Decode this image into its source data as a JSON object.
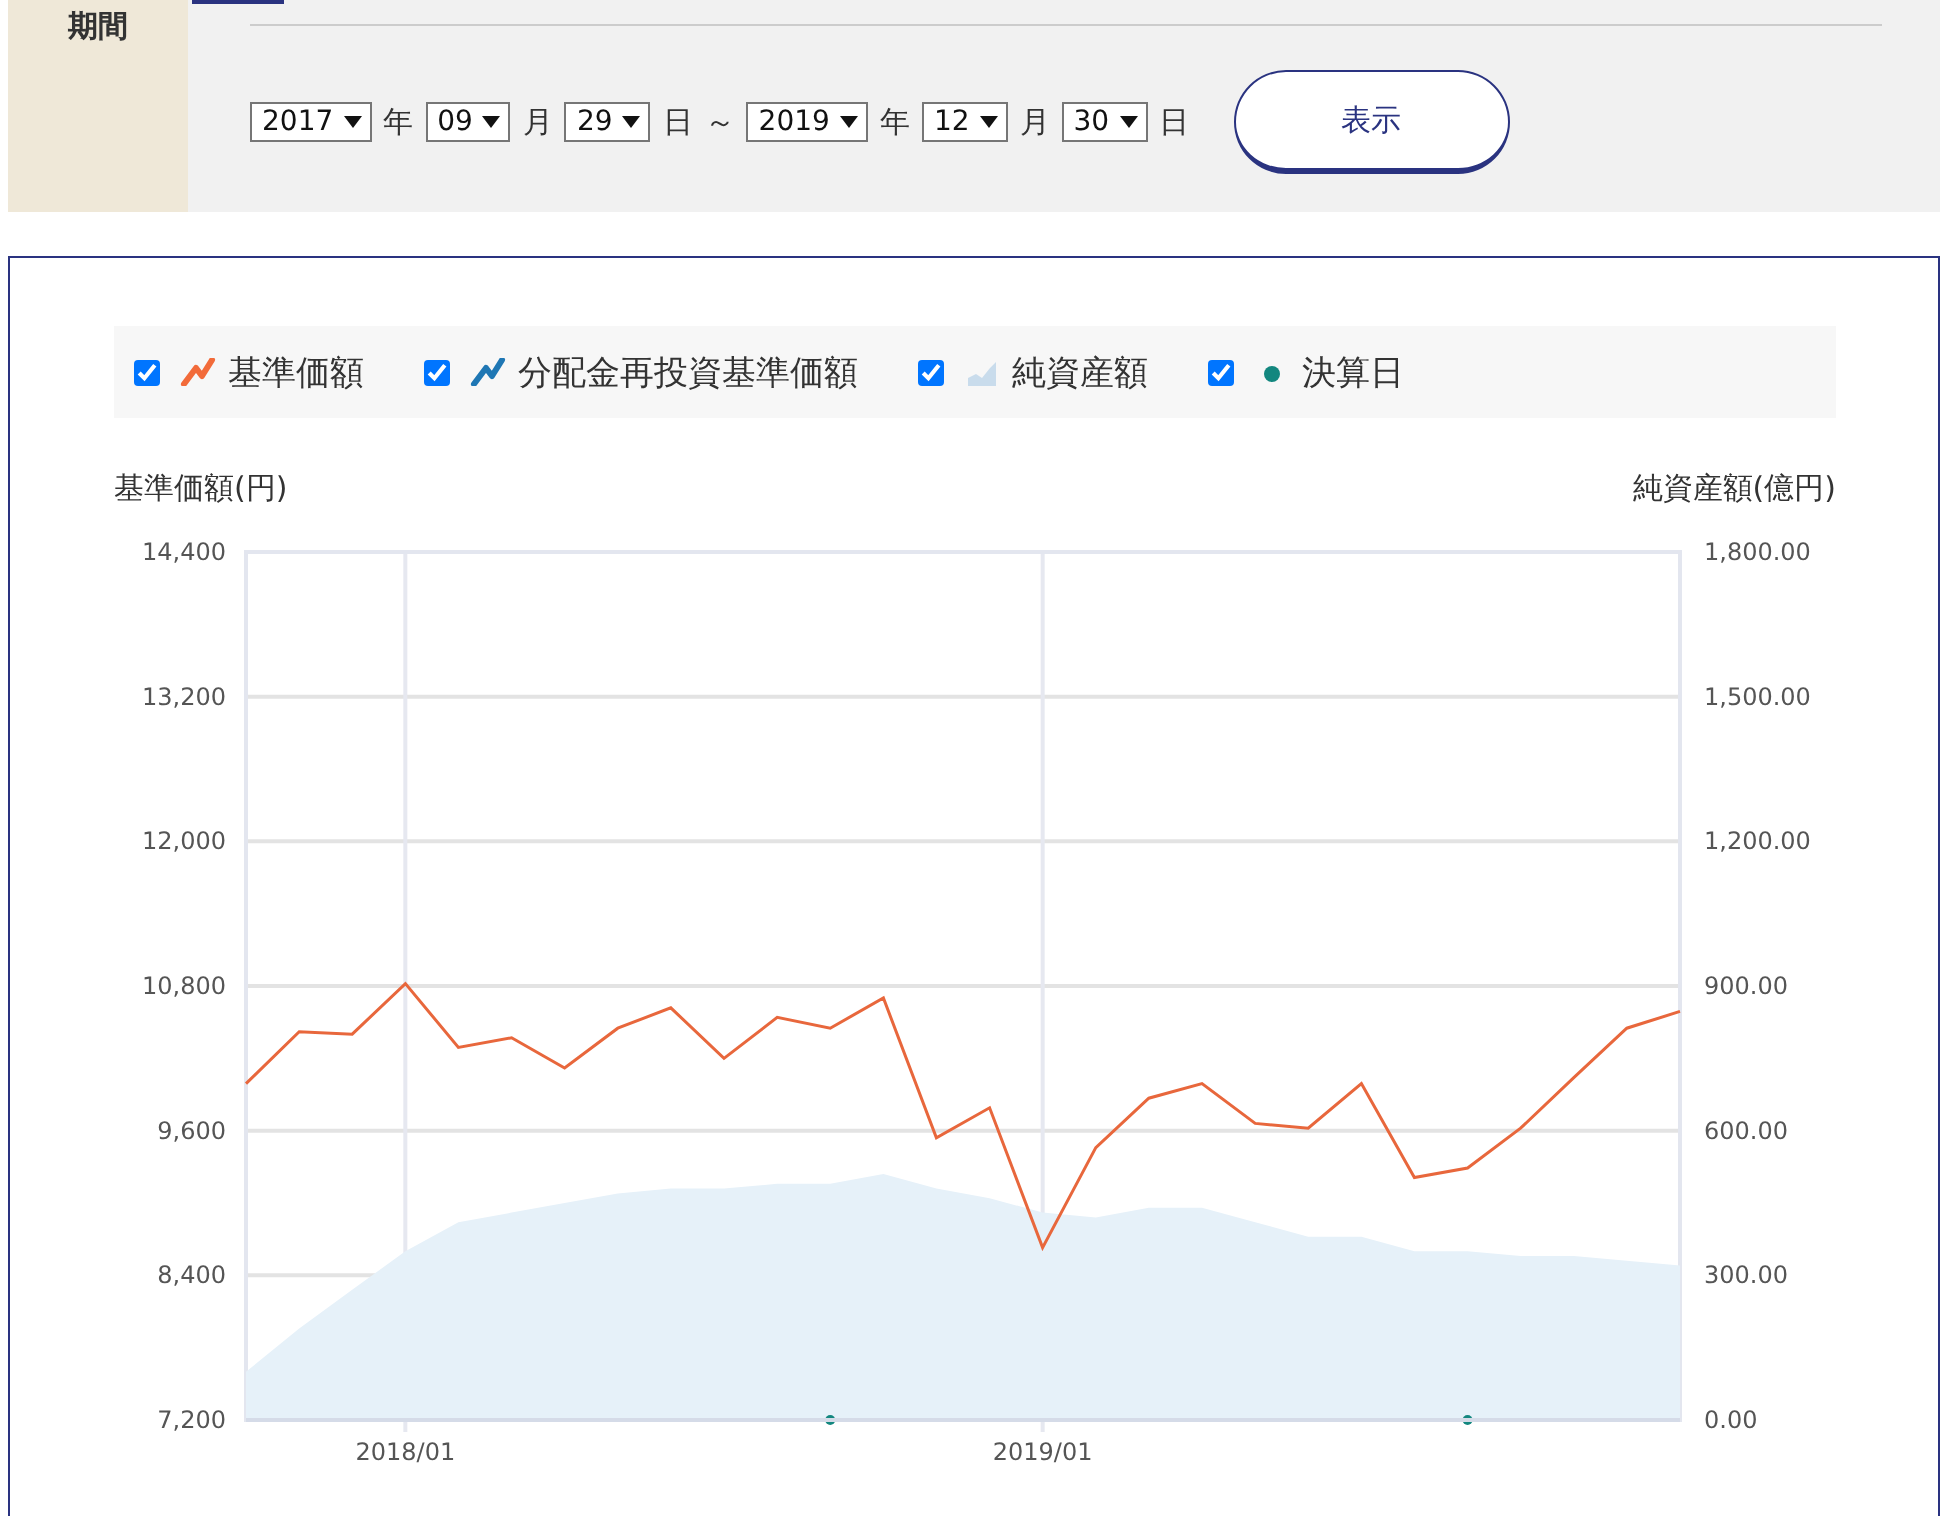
{
  "period": {
    "label": "期間",
    "parts": [
      {
        "kind": "select",
        "text": "2017"
      },
      {
        "kind": "unit",
        "text": "年"
      },
      {
        "kind": "select",
        "text": "09"
      },
      {
        "kind": "unit",
        "text": "月"
      },
      {
        "kind": "select",
        "text": "29"
      },
      {
        "kind": "unit",
        "text": "日"
      },
      {
        "kind": "unit",
        "text": "～"
      },
      {
        "kind": "select",
        "text": "2019"
      },
      {
        "kind": "unit",
        "text": "年"
      },
      {
        "kind": "select",
        "text": "12"
      },
      {
        "kind": "unit",
        "text": "月"
      },
      {
        "kind": "select",
        "text": "30"
      },
      {
        "kind": "unit",
        "text": "日"
      }
    ],
    "button": "表示"
  },
  "legend": {
    "items": [
      {
        "label": "基準価額",
        "checked": true,
        "color": "#f26b3a"
      },
      {
        "label": "分配金再投資基準価額",
        "checked": true,
        "color": "#1f77b4"
      },
      {
        "label": "純資産額",
        "checked": true,
        "color": "#c9dcec"
      },
      {
        "label": "決算日",
        "checked": true,
        "color": "#13877f"
      }
    ]
  },
  "chart": {
    "chart_data": {
      "type": "line",
      "ylabel": "基準価額(円)",
      "y2label": "純資産額(億円)",
      "categories": [
        null,
        null,
        null,
        "2018/01",
        null,
        null,
        null,
        null,
        null,
        null,
        null,
        null,
        null,
        null,
        null,
        "2019/01",
        null,
        null,
        null,
        null,
        null,
        null,
        null,
        null,
        null,
        null,
        null,
        null
      ],
      "grid": true,
      "ylim": [
        7200,
        14400
      ],
      "yticks": [
        {
          "value": 7200,
          "label": "7,200"
        },
        {
          "value": 8400,
          "label": "8,400"
        },
        {
          "value": 9600,
          "label": "9,600"
        },
        {
          "value": 10800,
          "label": "10,800"
        },
        {
          "value": 12000,
          "label": "12,000"
        },
        {
          "value": 13200,
          "label": "13,200"
        },
        {
          "value": 14400,
          "label": "14,400"
        }
      ],
      "y2lim": [
        0,
        1800
      ],
      "y2ticks": [
        {
          "value": 0,
          "label": "0.00"
        },
        {
          "value": 300,
          "label": "300.00"
        },
        {
          "value": 600,
          "label": "600.00"
        },
        {
          "value": 900,
          "label": "900.00"
        },
        {
          "value": 1200,
          "label": "1,200.00"
        },
        {
          "value": 1500,
          "label": "1,500.00"
        },
        {
          "value": 1800,
          "label": "1,800.00"
        }
      ],
      "series": [
        {
          "type": "area",
          "axis": "y2",
          "color": "#e6f1f9",
          "values": [
            100,
            190,
            270,
            350,
            410,
            430,
            450,
            470,
            480,
            480,
            490,
            490,
            510,
            480,
            460,
            430,
            420,
            440,
            440,
            410,
            380,
            380,
            350,
            350,
            340,
            340,
            330,
            320
          ]
        },
        {
          "color": "#e8673c",
          "values": [
            9990,
            10420,
            10400,
            10820,
            10290,
            10370,
            10120,
            10450,
            10620,
            10200,
            10540,
            10450,
            10700,
            9540,
            9790,
            8630,
            9460,
            9870,
            9990,
            9660,
            9620,
            9990,
            9210,
            9290,
            9620,
            10040,
            10450,
            10590
          ]
        },
        {
          "type": "scatter",
          "axis": "y2",
          "color": "#13877f",
          "values": [
            null,
            null,
            null,
            null,
            null,
            null,
            null,
            null,
            null,
            null,
            null,
            0,
            null,
            null,
            null,
            null,
            null,
            null,
            null,
            null,
            null,
            null,
            null,
            0,
            null,
            null,
            null,
            null
          ]
        }
      ]
    }
  }
}
